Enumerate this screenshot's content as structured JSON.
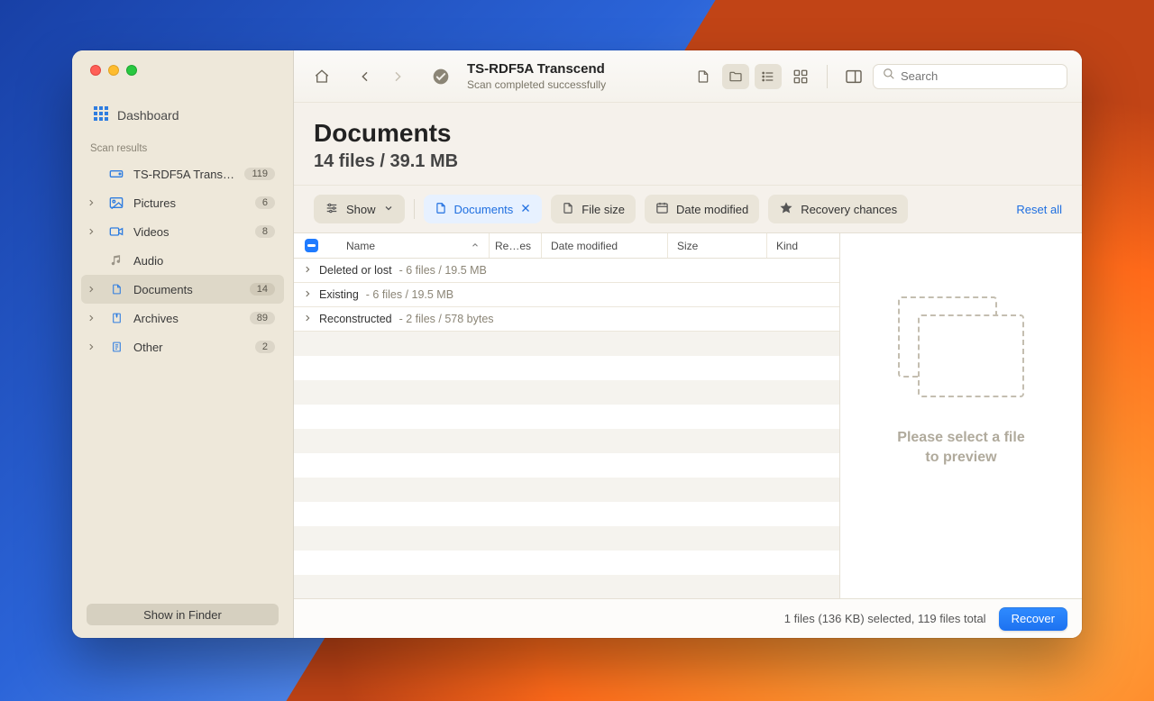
{
  "toolbar": {
    "title": "TS-RDF5A Transcend",
    "subtitle": "Scan completed successfully",
    "search_placeholder": "Search"
  },
  "sidebar": {
    "dashboard_label": "Dashboard",
    "section_label": "Scan results",
    "items": [
      {
        "label": "TS-RDF5A Transc…",
        "count": "119",
        "icon": "drive",
        "arrow": false
      },
      {
        "label": "Pictures",
        "count": "6",
        "icon": "picture",
        "arrow": true
      },
      {
        "label": "Videos",
        "count": "8",
        "icon": "video",
        "arrow": true
      },
      {
        "label": "Audio",
        "count": "",
        "icon": "audio",
        "arrow": false,
        "gray": true
      },
      {
        "label": "Documents",
        "count": "14",
        "icon": "doc",
        "arrow": true,
        "active": true
      },
      {
        "label": "Archives",
        "count": "89",
        "icon": "archive",
        "arrow": true
      },
      {
        "label": "Other",
        "count": "2",
        "icon": "other",
        "arrow": true
      }
    ],
    "show_in_finder": "Show in Finder"
  },
  "heading": {
    "title": "Documents",
    "subtitle": "14 files / 39.1 MB"
  },
  "filters": {
    "show": "Show",
    "documents": "Documents",
    "filesize": "File size",
    "date": "Date modified",
    "chances": "Recovery chances",
    "reset": "Reset all"
  },
  "columns": {
    "name": "Name",
    "re": "Re…es",
    "date": "Date modified",
    "size": "Size",
    "kind": "Kind"
  },
  "groups": [
    {
      "name": "Deleted or lost",
      "stats": "6 files / 19.5 MB"
    },
    {
      "name": "Existing",
      "stats": "6 files / 19.5 MB"
    },
    {
      "name": "Reconstructed",
      "stats": "2 files / 578 bytes"
    }
  ],
  "preview": {
    "line1": "Please select a file",
    "line2": "to preview"
  },
  "footer": {
    "status": "1 files (136 KB) selected, 119 files total",
    "recover": "Recover"
  }
}
